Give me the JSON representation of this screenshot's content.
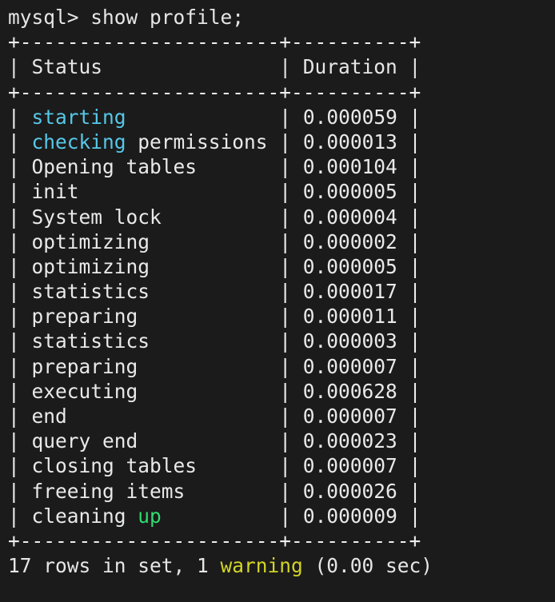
{
  "terminal": {
    "background_color": "#1b1b1b",
    "default_text_color": "#e9e9e9",
    "colors": {
      "cyan": "#56c8e8",
      "green": "#2fdc6e",
      "yellow": "#d2d426",
      "white": "#ededed"
    },
    "prompt_line": "mysql> show profile;",
    "prompt": "mysql>",
    "command": "show profile;",
    "rule_line": "+----------------------+----------+",
    "footer": {
      "prefix": "17 rows in set, 1 ",
      "highlight": "warning",
      "suffix": " (0.00 sec)",
      "full_text": "17 rows in set, 1 warning (0.00 sec)",
      "row_count": "17",
      "warning_count": "1",
      "elapsed": "0.00 sec"
    }
  },
  "table": {
    "columns": [
      {
        "name": "Status",
        "width_chars": 20,
        "header_line": "| Status               | Duration |"
      },
      {
        "name": "Duration",
        "width_chars": 8
      }
    ],
    "header_status": "Status",
    "header_duration": "Duration",
    "rows": [
      {
        "status_pre": "",
        "status_hl": "starting",
        "status_hl_color": "cyan",
        "status_post": "",
        "status_plain": "starting",
        "duration": "0.000059"
      },
      {
        "status_pre": "",
        "status_hl": "checking",
        "status_hl_color": "cyan",
        "status_post": " permissions",
        "status_plain": "checking permissions",
        "duration": "0.000013"
      },
      {
        "status_pre": "",
        "status_hl": "",
        "status_hl_color": "",
        "status_post": "",
        "status_plain": "Opening tables",
        "duration": "0.000104"
      },
      {
        "status_pre": "",
        "status_hl": "",
        "status_hl_color": "",
        "status_post": "",
        "status_plain": "init",
        "duration": "0.000005"
      },
      {
        "status_pre": "",
        "status_hl": "",
        "status_hl_color": "",
        "status_post": "",
        "status_plain": "System lock",
        "duration": "0.000004"
      },
      {
        "status_pre": "",
        "status_hl": "",
        "status_hl_color": "",
        "status_post": "",
        "status_plain": "optimizing",
        "duration": "0.000002"
      },
      {
        "status_pre": "",
        "status_hl": "",
        "status_hl_color": "",
        "status_post": "",
        "status_plain": "optimizing",
        "duration": "0.000005"
      },
      {
        "status_pre": "",
        "status_hl": "",
        "status_hl_color": "",
        "status_post": "",
        "status_plain": "statistics",
        "duration": "0.000017"
      },
      {
        "status_pre": "",
        "status_hl": "",
        "status_hl_color": "",
        "status_post": "",
        "status_plain": "preparing",
        "duration": "0.000011"
      },
      {
        "status_pre": "",
        "status_hl": "",
        "status_hl_color": "",
        "status_post": "",
        "status_plain": "statistics",
        "duration": "0.000003"
      },
      {
        "status_pre": "",
        "status_hl": "",
        "status_hl_color": "",
        "status_post": "",
        "status_plain": "preparing",
        "duration": "0.000007"
      },
      {
        "status_pre": "",
        "status_hl": "",
        "status_hl_color": "",
        "status_post": "",
        "status_plain": "executing",
        "duration": "0.000628"
      },
      {
        "status_pre": "",
        "status_hl": "",
        "status_hl_color": "",
        "status_post": "",
        "status_plain": "end",
        "duration": "0.000007"
      },
      {
        "status_pre": "",
        "status_hl": "",
        "status_hl_color": "",
        "status_post": "",
        "status_plain": "query end",
        "duration": "0.000023"
      },
      {
        "status_pre": "",
        "status_hl": "",
        "status_hl_color": "",
        "status_post": "",
        "status_plain": "closing tables",
        "duration": "0.000007"
      },
      {
        "status_pre": "",
        "status_hl": "",
        "status_hl_color": "",
        "status_post": "",
        "status_plain": "freeing items",
        "duration": "0.000026"
      },
      {
        "status_pre": "cleaning ",
        "status_hl": "up",
        "status_hl_color": "green",
        "status_post": "",
        "status_plain": "cleaning up",
        "duration": "0.000009"
      }
    ]
  }
}
